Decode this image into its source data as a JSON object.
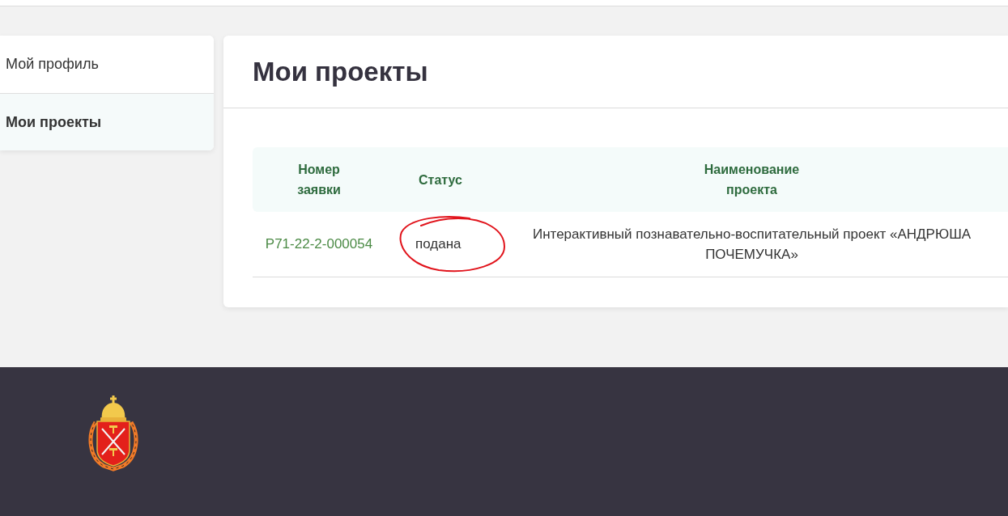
{
  "sidebar": {
    "items": [
      {
        "label": "Мой профиль",
        "selected": false
      },
      {
        "label": "Мои проекты",
        "selected": true
      }
    ]
  },
  "main": {
    "title": "Мои проекты",
    "table": {
      "columns": [
        "Номер заявки",
        "Статус",
        "Наименование проекта"
      ],
      "rows": [
        {
          "number": "Р71-22-2-000054",
          "status": "подана",
          "status_circled": true,
          "name": "Интерактивный познавательно-воспитательный проект «АНДРЮША ПОЧЕМУЧКА»"
        }
      ]
    }
  }
}
